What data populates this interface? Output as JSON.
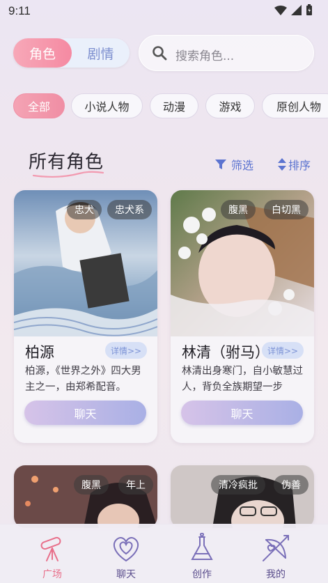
{
  "status": {
    "time": "9:11"
  },
  "tabs": {
    "characters": "角色",
    "stories": "剧情"
  },
  "search": {
    "placeholder": "搜索角色..."
  },
  "categories": [
    "全部",
    "小说人物",
    "动漫",
    "游戏",
    "原创人物"
  ],
  "section": {
    "title": "所有角色",
    "filter_label": "筛选",
    "sort_label": "排序"
  },
  "cards": [
    {
      "name": "柏源",
      "tags": [
        "忠犬",
        "忠犬系"
      ],
      "detail_label": "详情>>",
      "description": "柏源，《世界之外》四大男主之一，由郑希配音。",
      "chat_label": "聊天"
    },
    {
      "name": "林清（驸马）",
      "tags": [
        "腹黑",
        "白切黑"
      ],
      "detail_label": "详情>>",
      "description": "林清出身寒门，自小敏慧过人，背负全族期望一步",
      "chat_label": "聊天"
    },
    {
      "tags": [
        "腹黑",
        "年上"
      ]
    },
    {
      "tags": [
        "清冷疯批",
        "伪善"
      ]
    }
  ],
  "nav": [
    {
      "label": "广场",
      "icon": "telescope-icon",
      "active": true
    },
    {
      "label": "聊天",
      "icon": "heart-spiral-icon",
      "active": false
    },
    {
      "label": "创作",
      "icon": "potion-flask-icon",
      "active": false
    },
    {
      "label": "我的",
      "icon": "cupid-bow-icon",
      "active": false
    }
  ],
  "colors": {
    "accent_pink": "#f08ea4",
    "accent_blue": "#5c74d0",
    "nav_purple": "#5a4d8c"
  }
}
